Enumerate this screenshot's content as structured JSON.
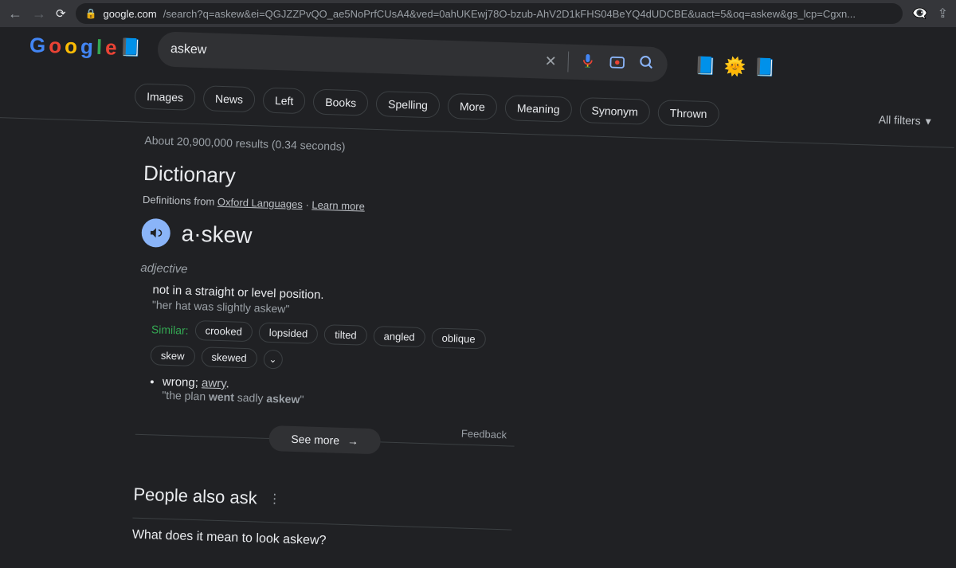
{
  "browser": {
    "url_host": "google.com",
    "url_path": "/search?q=askew&ei=QGJZZPvQO_ae5NoPrfCUsA4&ved=0ahUKEwj78O-bzub-AhV2D1kFHS04BeYQ4dUDCBE&uact=5&oq=askew&gs_lcp=Cgxn..."
  },
  "logo_letters": [
    "G",
    "o",
    "o",
    "g",
    "l",
    "e"
  ],
  "search": {
    "value": "askew"
  },
  "chips": [
    "Images",
    "News",
    "Left",
    "Books",
    "Spelling",
    "More",
    "Meaning",
    "Synonym",
    "Thrown"
  ],
  "all_filters": "All filters",
  "stats": "About 20,900,000 results (0.34 seconds)",
  "dictionary": {
    "heading": "Dictionary",
    "source_prefix": "Definitions from ",
    "source_link": "Oxford Languages",
    "learn_more": "Learn more",
    "word": "a·skew",
    "pos": "adjective",
    "definition": "not in a straight or level position.",
    "example": "\"her hat was slightly askew\"",
    "similar_label": "Similar:",
    "synonyms": [
      "crooked",
      "lopsided",
      "tilted",
      "angled",
      "oblique",
      "skew",
      "skewed"
    ],
    "sense2_text": "wrong; ",
    "sense2_link": "awry",
    "sense2_example_pre": "\"the plan ",
    "sense2_example_b1": "went",
    "sense2_example_mid": " sadly ",
    "sense2_example_b2": "askew",
    "sense2_example_post": "\"",
    "feedback": "Feedback",
    "see_more": "See more"
  },
  "paa": {
    "title": "People also ask",
    "q1": "What does it mean to look askew?"
  }
}
